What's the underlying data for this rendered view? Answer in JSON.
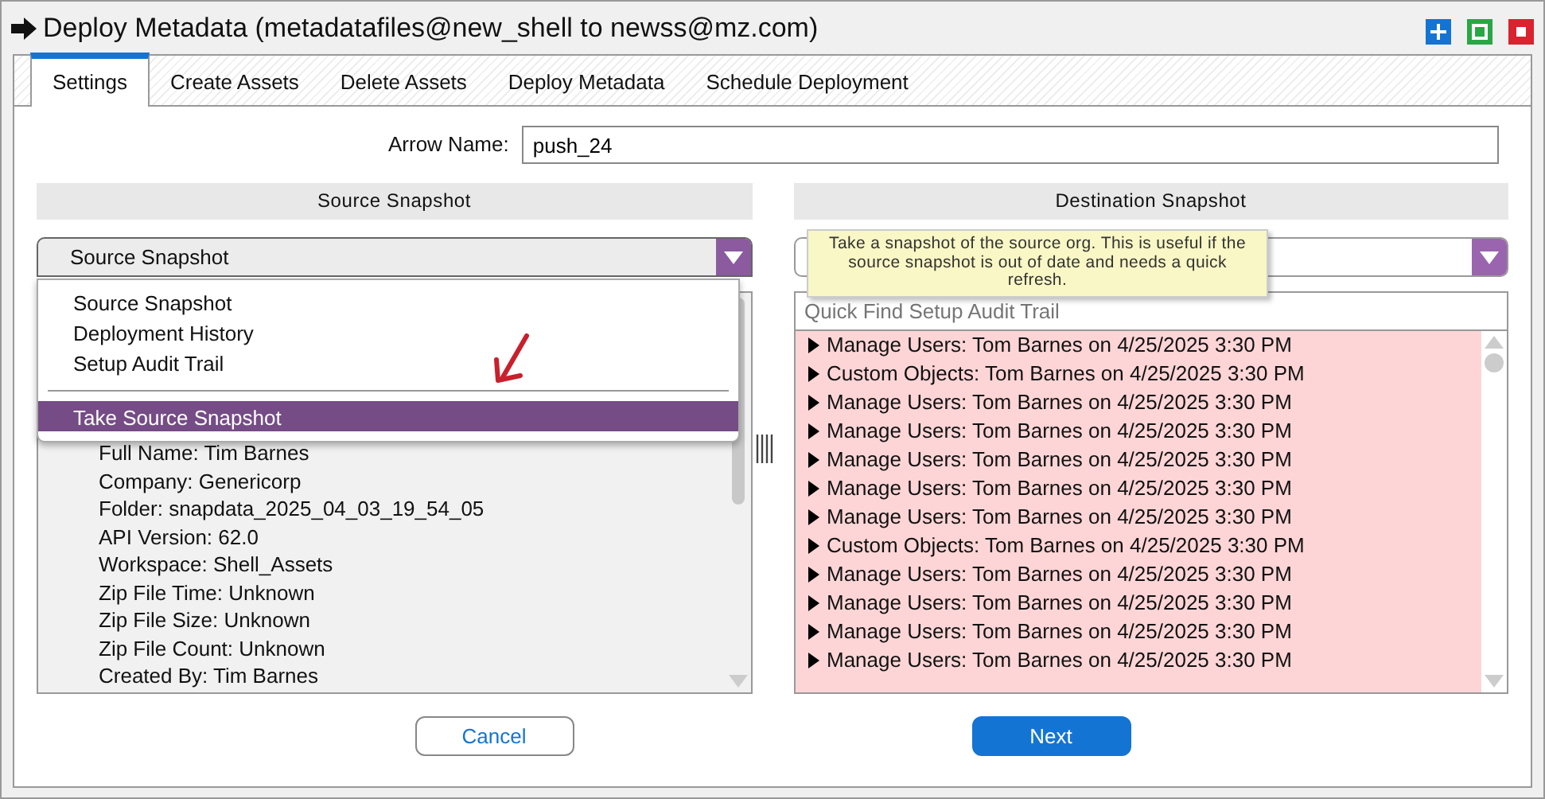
{
  "window": {
    "title": "Deploy Metadata (metadatafiles@new_shell to newss@mz.com)",
    "controls": [
      {
        "kind": "add"
      },
      {
        "kind": "maximize"
      },
      {
        "kind": "close"
      }
    ]
  },
  "tabs": [
    {
      "label": "Settings",
      "selected": true
    },
    {
      "label": "Create Assets",
      "selected": false
    },
    {
      "label": "Delete Assets",
      "selected": false
    },
    {
      "label": "Deploy Metadata",
      "selected": false
    },
    {
      "label": "Schedule Deployment",
      "selected": false
    }
  ],
  "arrow_name": {
    "label": "Arrow Name:",
    "value": "push_24"
  },
  "source": {
    "header": "Source Snapshot",
    "dropdown": {
      "value": "Source Snapshot",
      "expanded": true
    },
    "menu": [
      {
        "kind": "option",
        "label": "Source Snapshot",
        "selected": false
      },
      {
        "kind": "option",
        "label": "Deployment History",
        "selected": false
      },
      {
        "kind": "option",
        "label": "Setup Audit Trail",
        "selected": false
      },
      {
        "kind": "separator"
      },
      {
        "kind": "option",
        "label": "Take Source Snapshot",
        "selected": true
      }
    ],
    "details": [
      "Full Name: Tim Barnes",
      "Company: Genericorp",
      "Folder: snapdata_2025_04_03_19_54_05",
      "API Version: 62.0",
      "Workspace: Shell_Assets",
      "Zip File Time: Unknown",
      "Zip File Size: Unknown",
      "Zip File Count: Unknown",
      "Created By: Tim Barnes"
    ]
  },
  "destination": {
    "header": "Destination Snapshot",
    "search": {
      "placeholder": "Quick Find Setup Audit Trail"
    },
    "entries": [
      {
        "text": "Manage Users: Tom Barnes on 4/25/2025 3:30 PM",
        "expanded": false
      },
      {
        "text": "Custom Objects: Tom Barnes on 4/25/2025 3:30 PM",
        "expanded": false
      },
      {
        "text": "Manage Users: Tom Barnes on 4/25/2025 3:30 PM",
        "expanded": false
      },
      {
        "text": "Manage Users: Tom Barnes on 4/25/2025 3:30 PM",
        "expanded": false
      },
      {
        "text": "Manage Users: Tom Barnes on 4/25/2025 3:30 PM",
        "expanded": false
      },
      {
        "text": "Manage Users: Tom Barnes on 4/25/2025 3:30 PM",
        "expanded": false
      },
      {
        "text": "Manage Users: Tom Barnes on 4/25/2025 3:30 PM",
        "expanded": false
      },
      {
        "text": "Custom Objects: Tom Barnes on 4/25/2025 3:30 PM",
        "expanded": false
      },
      {
        "text": "Manage Users: Tom Barnes on 4/25/2025 3:30 PM",
        "expanded": false
      },
      {
        "text": "Manage Users: Tom Barnes on 4/25/2025 3:30 PM",
        "expanded": false
      },
      {
        "text": "Manage Users: Tom Barnes on 4/25/2025 3:30 PM",
        "expanded": false
      },
      {
        "text": "Manage Users: Tom Barnes on 4/25/2025 3:30 PM",
        "expanded": false
      }
    ]
  },
  "tooltip": {
    "text": "Take a snapshot of the source org. This is useful if the source snapshot is out of date and needs a quick refresh."
  },
  "buttons": [
    {
      "label": "Cancel",
      "kind": "secondary"
    },
    {
      "label": "Next",
      "kind": "primary"
    }
  ]
}
